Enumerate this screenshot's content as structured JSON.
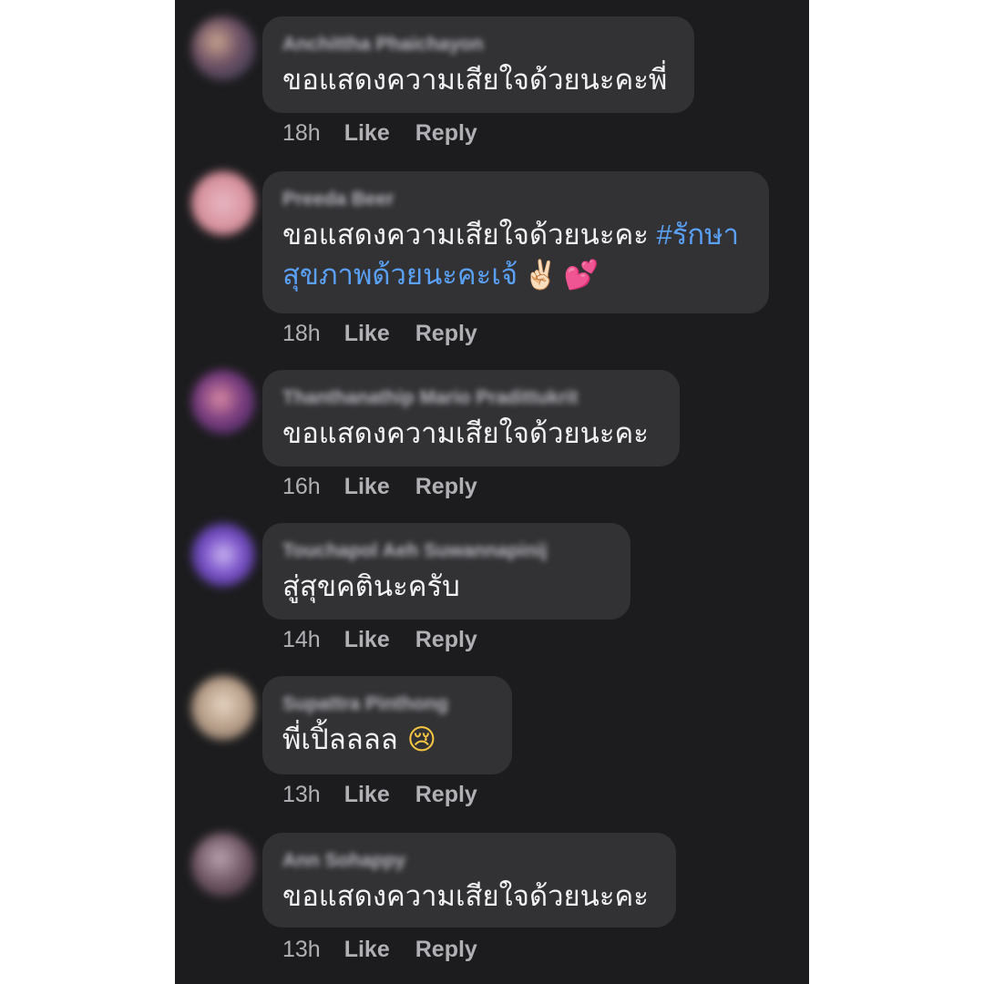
{
  "actions": {
    "like_label": "Like",
    "reply_label": "Reply"
  },
  "comments": [
    {
      "author": "Anchittha Phaichayon",
      "text": "ขอแสดงความเสียใจด้วยนะคะพี่",
      "time": "18h"
    },
    {
      "author": "Preeda Beer",
      "text_line1": "ขอแสดงความเสียใจด้วยนะคะ",
      "hashtag_line1": "#รักษา",
      "hashtag_line2": "สุขภาพด้วยนะคะเจ้",
      "emoji_1": "✌🏻",
      "emoji_2": "💕",
      "time": "18h"
    },
    {
      "author": "Thanthanathip Mario Pradittukrit",
      "text": "ขอแสดงความเสียใจด้วยนะคะ",
      "time": "16h"
    },
    {
      "author": "Touchapol Aeh Suwannapinij",
      "text": "สู่สุขคตินะครับ",
      "time": "14h"
    },
    {
      "author": "Supattra Pinthong",
      "text": "พี่เปิ้ลลลล",
      "emoji": "😢",
      "time": "13h"
    },
    {
      "author": "Ann Sohappy",
      "text": "ขอแสดงความเสียใจด้วยนะคะ",
      "time": "13h"
    }
  ],
  "colors": {
    "background": "#1c1c1e",
    "bubble": "#323235",
    "text": "#f2f2f4",
    "meta": "#b0b0b5",
    "hashtag": "#5aa0f5"
  }
}
